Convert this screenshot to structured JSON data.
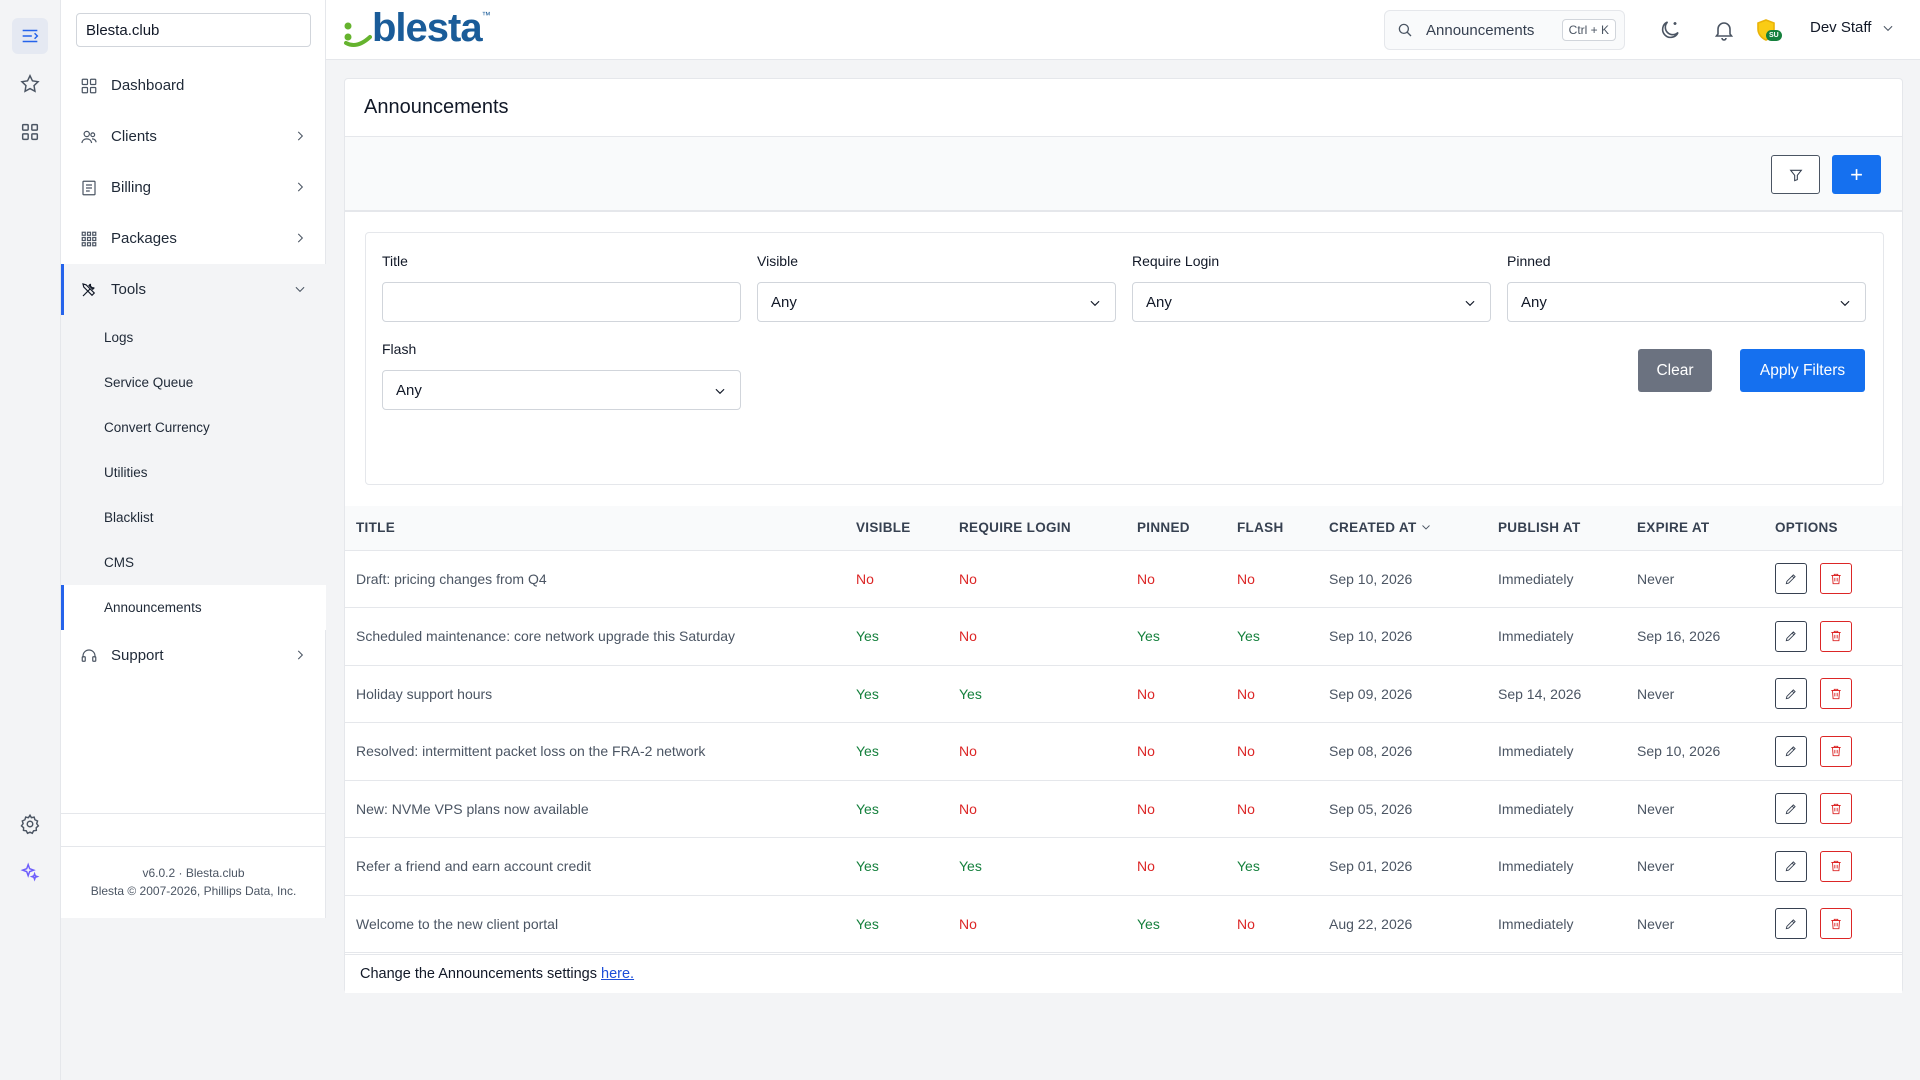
{
  "app": {
    "site_name": "Blesta.club",
    "logo_text": "blesta",
    "logo_tm": "™"
  },
  "header": {
    "search_placeholder": "Announcements",
    "search_shortcut": "Ctrl + K",
    "user_name": "Dev Staff",
    "badge_text": "SU"
  },
  "sidebar": {
    "items": [
      {
        "label": "Dashboard",
        "icon": "dashboard-icon"
      },
      {
        "label": "Clients",
        "icon": "users-icon"
      },
      {
        "label": "Billing",
        "icon": "billing-icon"
      },
      {
        "label": "Packages",
        "icon": "packages-icon"
      },
      {
        "label": "Tools",
        "icon": "tools-icon"
      },
      {
        "label": "Support",
        "icon": "headset-icon"
      }
    ],
    "tools_sub": [
      "Logs",
      "Service Queue",
      "Convert Currency",
      "Utilities",
      "Blacklist",
      "CMS",
      "Announcements"
    ],
    "footer_version": "v6.0.2 · Blesta.club",
    "footer_copyright": "Blesta © 2007-2026, Phillips Data, Inc."
  },
  "page": {
    "title": "Announcements",
    "add_label": "+",
    "filters": {
      "title_label": "Title",
      "title_value": "",
      "visible_label": "Visible",
      "visible_value": "Any",
      "login_label": "Require Login",
      "login_value": "Any",
      "pinned_label": "Pinned",
      "pinned_value": "Any",
      "flash_label": "Flash",
      "flash_value": "Any",
      "clear_label": "Clear",
      "apply_label": "Apply Filters"
    },
    "columns": [
      "TITLE",
      "VISIBLE",
      "REQUIRE LOGIN",
      "PINNED",
      "FLASH",
      "CREATED AT",
      "PUBLISH AT",
      "EXPIRE AT",
      "OPTIONS"
    ],
    "rows": [
      {
        "title": "Draft: pricing changes from Q4",
        "visible": "No",
        "login": "No",
        "pinned": "No",
        "flash": "No",
        "created": "Sep 10, 2026",
        "publish": "Immediately",
        "expire": "Never"
      },
      {
        "title": "Scheduled maintenance: core network upgrade this Saturday",
        "visible": "Yes",
        "login": "No",
        "pinned": "Yes",
        "flash": "Yes",
        "created": "Sep 10, 2026",
        "publish": "Immediately",
        "expire": "Sep 16, 2026"
      },
      {
        "title": "Holiday support hours",
        "visible": "Yes",
        "login": "Yes",
        "pinned": "No",
        "flash": "No",
        "created": "Sep 09, 2026",
        "publish": "Sep 14, 2026",
        "expire": "Never"
      },
      {
        "title": "Resolved: intermittent packet loss on the FRA-2 network",
        "visible": "Yes",
        "login": "No",
        "pinned": "No",
        "flash": "No",
        "created": "Sep 08, 2026",
        "publish": "Immediately",
        "expire": "Sep 10, 2026"
      },
      {
        "title": "New: NVMe VPS plans now available",
        "visible": "Yes",
        "login": "No",
        "pinned": "No",
        "flash": "No",
        "created": "Sep 05, 2026",
        "publish": "Immediately",
        "expire": "Never"
      },
      {
        "title": "Refer a friend and earn account credit",
        "visible": "Yes",
        "login": "Yes",
        "pinned": "No",
        "flash": "Yes",
        "created": "Sep 01, 2026",
        "publish": "Immediately",
        "expire": "Never"
      },
      {
        "title": "Welcome to the new client portal",
        "visible": "Yes",
        "login": "No",
        "pinned": "Yes",
        "flash": "No",
        "created": "Aug 22, 2026",
        "publish": "Immediately",
        "expire": "Never"
      }
    ],
    "footer_text": "Change the Announcements settings",
    "footer_link": "here."
  },
  "colors": {
    "primary": "#1570ef",
    "yes": "#15803d",
    "no": "#dc2626",
    "logo": "#1a5c99",
    "logo_dots": "#65b32e"
  }
}
